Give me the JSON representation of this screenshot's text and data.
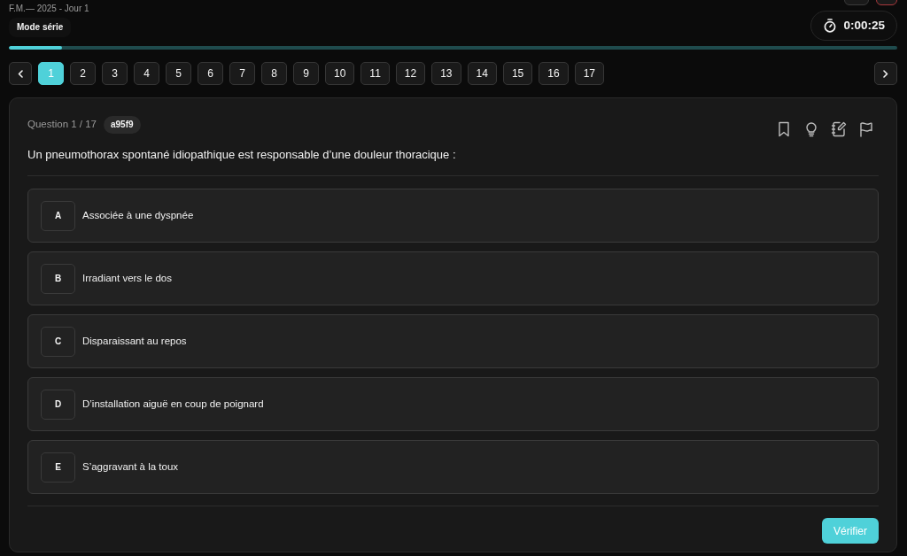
{
  "header": {
    "subtitle": "F.M.— 2025 - Jour 1",
    "mode": "Mode série",
    "timer": "0:00:25"
  },
  "progress": {
    "level": 0.06
  },
  "pager": {
    "pages": [
      {
        "label": "1",
        "selected": true
      },
      {
        "label": "2",
        "selected": false
      },
      {
        "label": "3",
        "selected": false
      },
      {
        "label": "4",
        "selected": false
      },
      {
        "label": "5",
        "selected": false
      },
      {
        "label": "6",
        "selected": false
      },
      {
        "label": "7",
        "selected": false
      },
      {
        "label": "8",
        "selected": false
      },
      {
        "label": "9",
        "selected": false
      },
      {
        "label": "10",
        "selected": false
      },
      {
        "label": "11",
        "selected": false
      },
      {
        "label": "12",
        "selected": false
      },
      {
        "label": "13",
        "selected": false
      },
      {
        "label": "14",
        "selected": false
      },
      {
        "label": "15",
        "selected": false
      },
      {
        "label": "16",
        "selected": false
      },
      {
        "label": "17",
        "selected": false
      }
    ]
  },
  "question": {
    "counter": "Question 1 / 17",
    "id_badge": "a95f9",
    "text": "Un pneumothorax spontané idiopathique est responsable d’une douleur thoracique :",
    "options": [
      {
        "letter": "A",
        "text": "Associée à une dyspnée",
        "selected": false
      },
      {
        "letter": "B",
        "text": "Irradiant vers le dos",
        "selected": false
      },
      {
        "letter": "C",
        "text": "Disparaissant au repos",
        "selected": false
      },
      {
        "letter": "D",
        "text": "D’installation aiguë en coup de poignard",
        "selected": false
      },
      {
        "letter": "E",
        "text": "S’aggravant à la toux",
        "selected": false
      }
    ]
  },
  "actions": {
    "verify": "Vérifier"
  }
}
